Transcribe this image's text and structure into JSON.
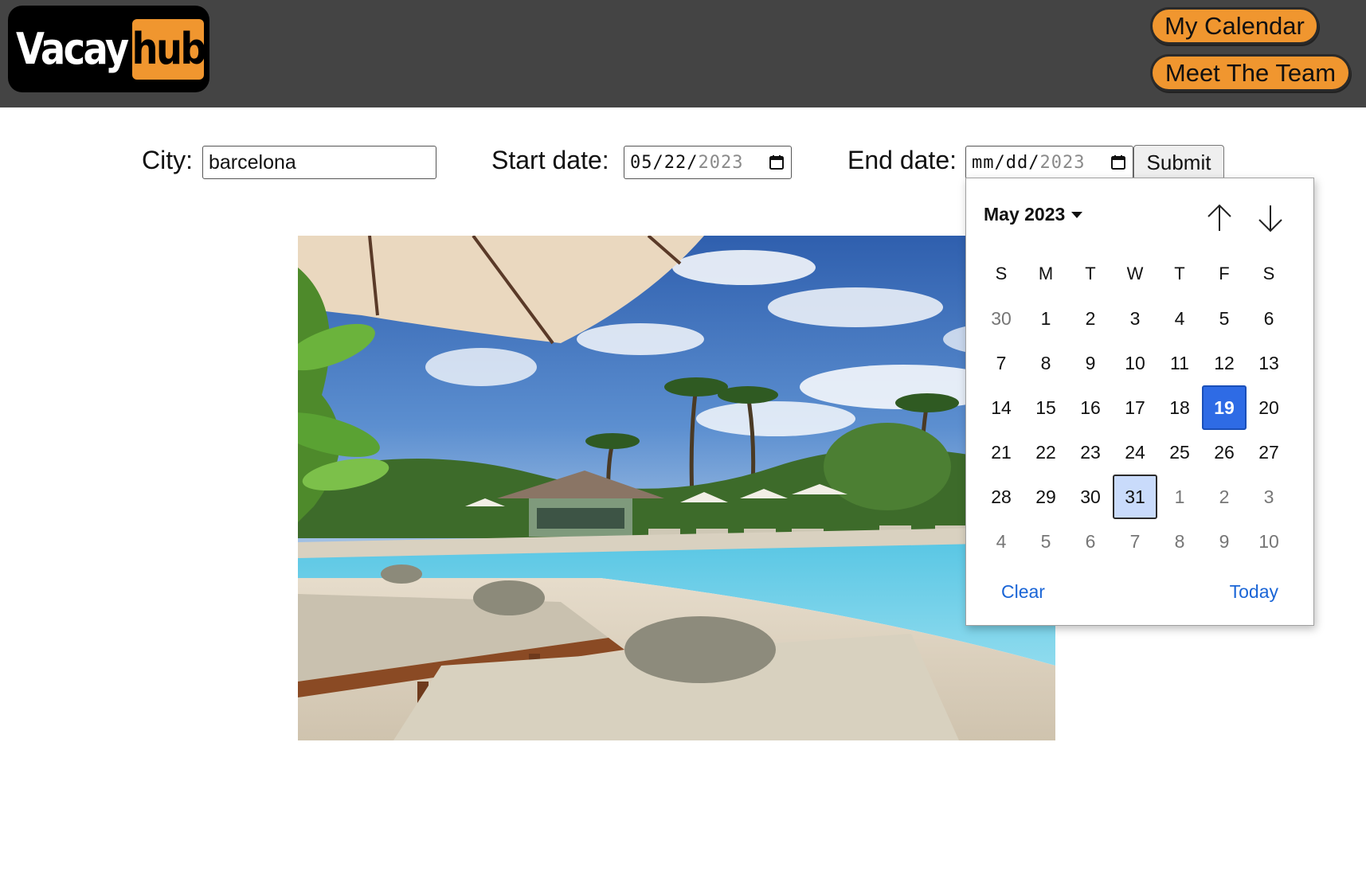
{
  "header": {
    "logo": {
      "part1": "Vacay",
      "part2": "hub"
    },
    "nav": {
      "my_calendar": "My Calendar",
      "meet_the_team": "Meet The Team"
    }
  },
  "form": {
    "city_label": "City:",
    "city_value": "barcelona",
    "start_label": "Start date:",
    "start_value": {
      "mm": "05",
      "dd": "22",
      "yyyy": "2023"
    },
    "end_label": "End date:",
    "end_value": {
      "mm": "mm",
      "dd": "dd",
      "yyyy": "2023"
    },
    "submit_label": "Submit"
  },
  "datepicker": {
    "month_title": "May 2023",
    "weekdays": [
      "S",
      "M",
      "T",
      "W",
      "T",
      "F",
      "S"
    ],
    "weeks": [
      [
        "30",
        "1",
        "2",
        "3",
        "4",
        "5",
        "6"
      ],
      [
        "7",
        "8",
        "9",
        "10",
        "11",
        "12",
        "13"
      ],
      [
        "14",
        "15",
        "16",
        "17",
        "18",
        "19",
        "20"
      ],
      [
        "21",
        "22",
        "23",
        "24",
        "25",
        "26",
        "27"
      ],
      [
        "28",
        "29",
        "30",
        "31",
        "1",
        "2",
        "3"
      ],
      [
        "4",
        "5",
        "6",
        "7",
        "8",
        "9",
        "10"
      ]
    ],
    "today_day": "19",
    "highlighted_day": "31",
    "clear_label": "Clear",
    "today_label": "Today"
  },
  "colors": {
    "header_bg": "#444444",
    "accent": "#f0962f",
    "today_bg": "#2e6be5",
    "hover_bg": "#c9dbfb",
    "link": "#1a65d6"
  },
  "icons": {
    "calendar": "calendar-icon",
    "up": "arrow-up-icon",
    "down": "arrow-down-icon",
    "caret": "caret-down-icon"
  }
}
